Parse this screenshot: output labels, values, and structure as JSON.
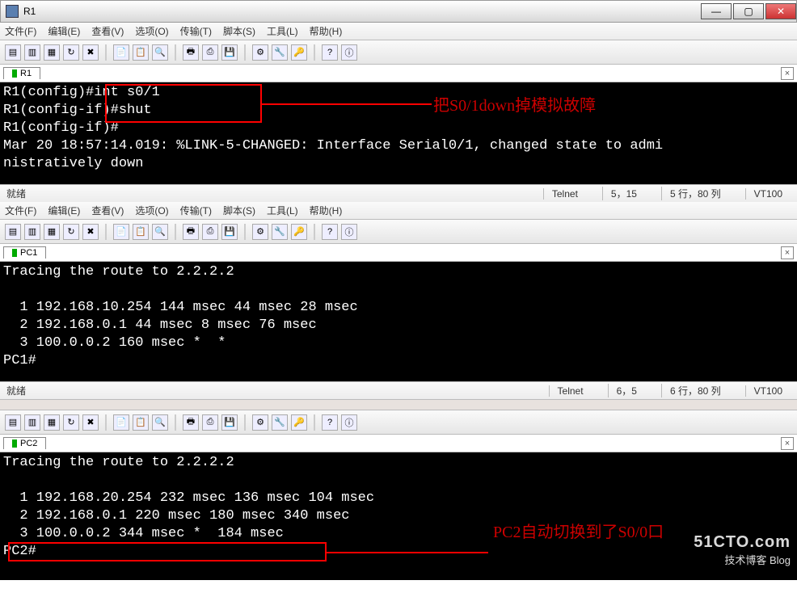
{
  "window": {
    "title": "R1",
    "min": "—",
    "max": "▢",
    "close": "✕"
  },
  "menu": {
    "file": "文件(F)",
    "edit": "编辑(E)",
    "view": "查看(V)",
    "options": "选项(O)",
    "transfer": "传输(T)",
    "script": "脚本(S)",
    "tools": "工具(L)",
    "help": "帮助(H)"
  },
  "tabs": {
    "r1": "R1",
    "pc1": "PC1",
    "pc2": "PC2",
    "closeX": "×"
  },
  "terminals": {
    "r1": "R1(config)#int s0/1\nR1(config-if)#shut\nR1(config-if)#\nMar 20 18:57:14.019: %LINK-5-CHANGED: Interface Serial0/1, changed state to admi\nnistratively down",
    "pc1": "Tracing the route to 2.2.2.2\n\n  1 192.168.10.254 144 msec 44 msec 28 msec\n  2 192.168.0.1 44 msec 8 msec 76 msec\n  3 100.0.0.2 160 msec *  *\nPC1#",
    "pc2": "Tracing the route to 2.2.2.2\n\n  1 192.168.20.254 232 msec 136 msec 104 msec\n  2 192.168.0.1 220 msec 180 msec 340 msec\n  3 100.0.0.2 344 msec *  184 msec\nPC2#"
  },
  "status": {
    "ready": "就绪",
    "protocol": "Telnet",
    "r1_pos": "5，15",
    "r1_size": "5 行，80 列",
    "pc1_pos": "6，5",
    "pc1_size": "6 行，80 列",
    "vt": "VT100"
  },
  "annotations": {
    "r1": "把S0/1down掉模拟故障",
    "pc2": "PC2自动切换到了S0/0口"
  },
  "watermark": {
    "big": "51CTO.com",
    "small": "技术博客   Blog"
  }
}
